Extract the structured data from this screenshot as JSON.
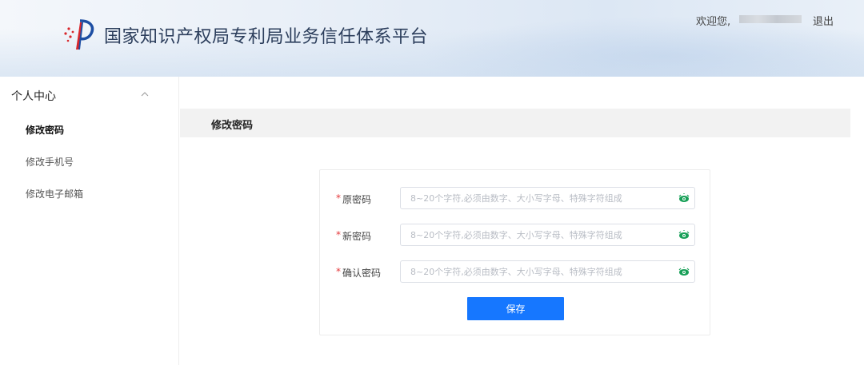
{
  "header": {
    "site_title": "国家知识产权局专利局业务信任体系平台",
    "welcome_text": "欢迎您,",
    "logout_label": "退出"
  },
  "sidebar": {
    "group_label": "个人中心",
    "items": [
      {
        "label": "修改密码",
        "active": true
      },
      {
        "label": "修改手机号",
        "active": false
      },
      {
        "label": "修改电子邮箱",
        "active": false
      }
    ]
  },
  "main": {
    "section_title": "修改密码",
    "form": {
      "fields": [
        {
          "label": "原密码",
          "required_mark": "*",
          "placeholder": "8~20个字符,必须由数字、大小写字母、特殊字符组成",
          "value": ""
        },
        {
          "label": "新密码",
          "required_mark": "*",
          "placeholder": "8~20个字符,必须由数字、大小写字母、特殊字符组成",
          "value": ""
        },
        {
          "label": "确认密码",
          "required_mark": "*",
          "placeholder": "8~20个字符,必须由数字、大小写字母、特殊字符组成",
          "value": ""
        }
      ],
      "save_label": "保存"
    }
  },
  "colors": {
    "primary": "#1677ff",
    "required": "#e4393c",
    "eye_icon": "#18a058",
    "logo_red": "#d8262b",
    "logo_blue": "#1d4ea3"
  },
  "icons": {
    "logo": "cnipa-logo-icon",
    "chevron": "chevron-up-icon",
    "eye": "eye-icon"
  }
}
